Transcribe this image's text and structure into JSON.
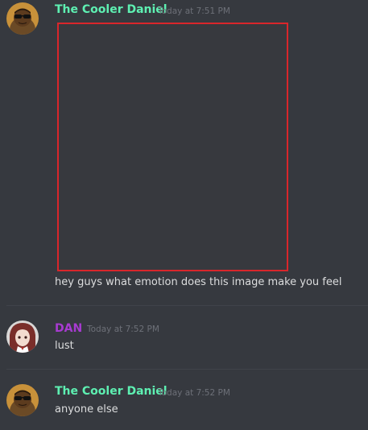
{
  "messages": [
    {
      "author": "The Cooler Daniel",
      "author_color": "#5ef0b2",
      "timestamp": "Today at 7:51 PM",
      "avatar": "sunglasses-avatar",
      "attachment": "image",
      "text": "hey guys what emotion does this image make you feel"
    },
    {
      "author": "DAN",
      "author_color": "#a83bd1",
      "timestamp": "Today at 7:52 PM",
      "avatar": "anime-girl-avatar",
      "text": "lust"
    },
    {
      "author": "The Cooler Daniel",
      "author_color": "#5ef0b2",
      "timestamp": "Today at 7:52 PM",
      "avatar": "sunglasses-avatar",
      "text": "anyone else"
    }
  ],
  "theme": {
    "background": "#36393f",
    "attachment_border": "#d9262b"
  }
}
